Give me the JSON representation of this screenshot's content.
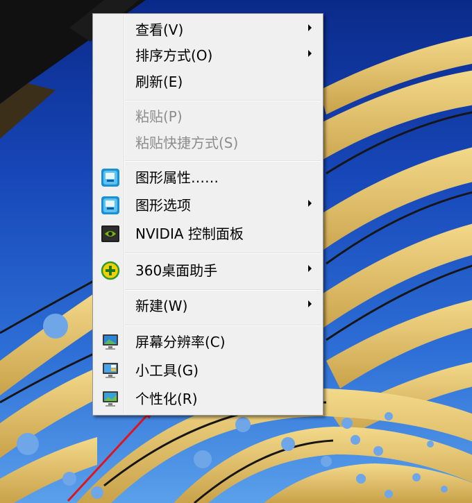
{
  "context_menu": {
    "items": [
      {
        "label": "查看(V)",
        "submenu": true,
        "enabled": true
      },
      {
        "label": "排序方式(O)",
        "submenu": true,
        "enabled": true
      },
      {
        "label": "刷新(E)",
        "submenu": false,
        "enabled": true
      },
      {
        "label": "粘贴(P)",
        "submenu": false,
        "enabled": false
      },
      {
        "label": "粘贴快捷方式(S)",
        "submenu": false,
        "enabled": false
      },
      {
        "label": "图形属性……",
        "submenu": false,
        "enabled": true,
        "icon": "intel-graphics-icon"
      },
      {
        "label": "图形选项",
        "submenu": true,
        "enabled": true,
        "icon": "intel-graphics-icon"
      },
      {
        "label": "NVIDIA 控制面板",
        "submenu": false,
        "enabled": true,
        "icon": "nvidia-icon"
      },
      {
        "label": "360桌面助手",
        "submenu": true,
        "enabled": true,
        "icon": "360-plus-icon"
      },
      {
        "label": "新建(W)",
        "submenu": true,
        "enabled": true
      },
      {
        "label": "屏幕分辨率(C)",
        "submenu": false,
        "enabled": true,
        "icon": "monitor-icon"
      },
      {
        "label": "小工具(G)",
        "submenu": false,
        "enabled": true,
        "icon": "gadgets-icon"
      },
      {
        "label": "个性化(R)",
        "submenu": false,
        "enabled": true,
        "icon": "personalize-icon"
      }
    ]
  },
  "colors": {
    "menu_background": "#f0f0f0",
    "disabled_text": "#8c8c8c",
    "annotation_arrow": "#e0141c"
  }
}
